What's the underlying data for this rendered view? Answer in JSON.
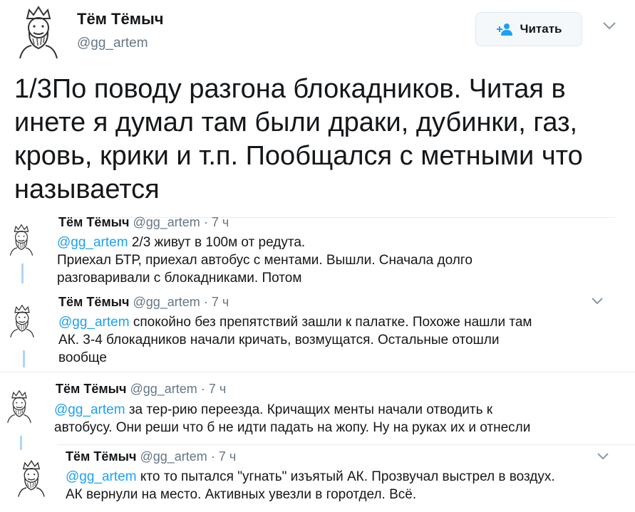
{
  "main": {
    "name": "Тём Тёмыч",
    "handle": "@gg_artem",
    "follow_label": "Читать",
    "follow_icon": "add-user-icon",
    "text": "1/3По поводу разгона блокадников. Читая в инете я думал там были драки, дубинки, газ, кровь, крики и т.п. Пообщался с метными что называется"
  },
  "replies": [
    {
      "name": "Тём Тёмыч",
      "handle": "@gg_artem",
      "time": "· 7 ч",
      "mention": "@gg_artem",
      "line1": "2/3 живут в 100м от редута.",
      "line2": "Приехал БТР, приехал автобус с ментами. Вышли. Сначала долго",
      "line3": "разговаривали с блокадниками. Потом"
    },
    {
      "name": "Тём Тёмыч",
      "handle": "@gg_artem",
      "time": "· 7 ч",
      "mention": "@gg_artem",
      "line1": "спокойно без препятствий зашли к палатке. Похоже нашли там",
      "line2": "АК. 3-4 блокадников начали кричать, возмущатся. Остальные отошли",
      "line3": "вообще"
    },
    {
      "name": "Тём Тёмыч",
      "handle": "@gg_artem",
      "time": "· 7 ч",
      "mention": "@gg_artem",
      "line1": "за тер-рию переезда. Кричащих менты начали отводить к",
      "line2": "автобусу. Они реши что б не идти падать на жопу. Ну на руках их и отнесли"
    },
    {
      "name": "Тём Тёмыч",
      "handle": "@gg_artem",
      "time": "· 7 ч",
      "mention": "@gg_artem",
      "line1": "кто то пытался \"угнать\" изъятый АК. Прозвучал выстрел в воздух.",
      "line2": "АК вернули на место. Активных увезли в горотдел. Всё."
    }
  ],
  "colors": {
    "link": "#1da1f2",
    "muted": "#657786",
    "text": "#14171a",
    "thread": "#abd6f7"
  }
}
